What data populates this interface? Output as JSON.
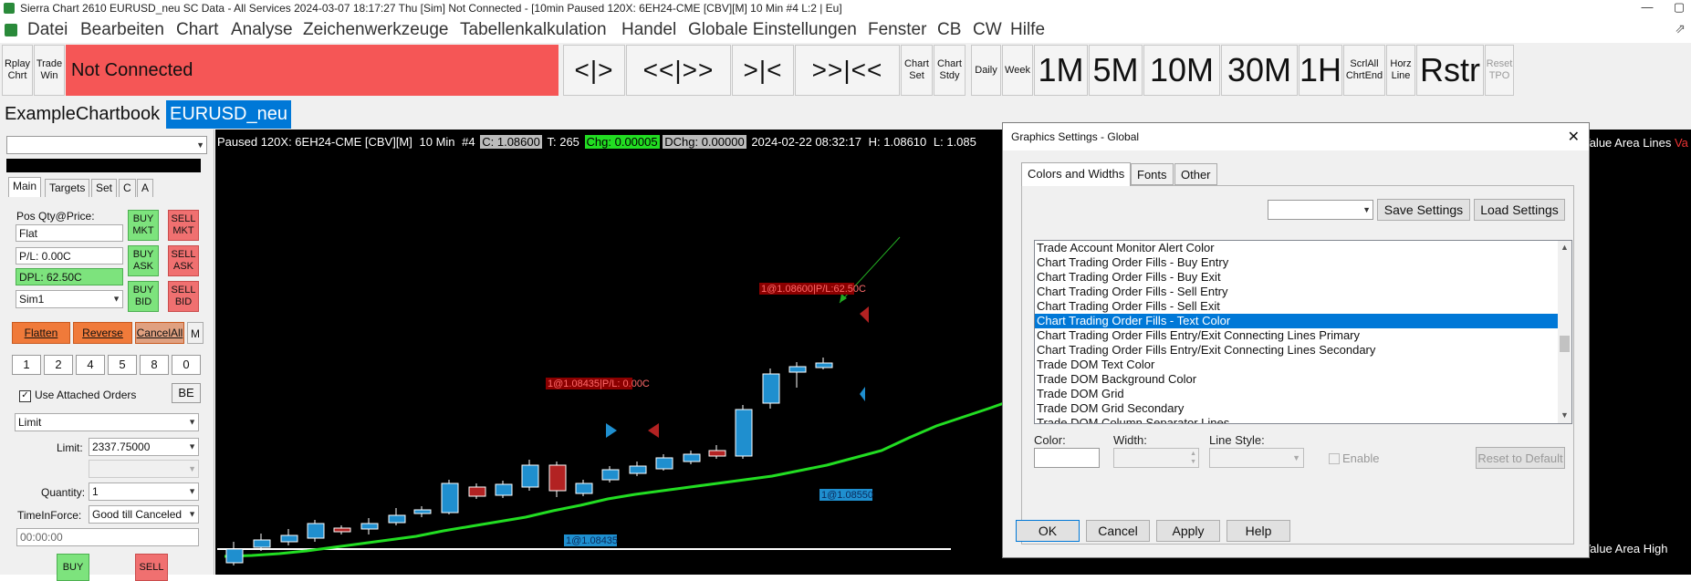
{
  "window": {
    "title": "Sierra Chart 2610 EURUSD_neu SC Data - All Services 2024-03-07  18:17:27 Thu [Sim] Not Connected - [10min Paused 120X: 6EH24-CME [CBV][M]  10 Min  #4 L:2 | Eu]",
    "minimize": "—",
    "restore": "▢",
    "menu_restore": "⇗"
  },
  "menu": [
    "Datei",
    "Bearbeiten",
    "Chart",
    "Analyse",
    "Zeichenwerkzeuge",
    "Tabellenkalkulation",
    "Handel",
    "Globale Einstellungen",
    "Fenster",
    "CB",
    "CW",
    "Hilfe"
  ],
  "toolbar": {
    "rplay": "Rplay Chrt",
    "trade_win": "Trade Win",
    "status": "Not Connected",
    "nav": [
      "<|>",
      "<<|>>",
      ">|<",
      ">>|<<"
    ],
    "chart_set": "Chart Set",
    "chart_stdy": "Chart Stdy",
    "daily": "Daily",
    "week": "Week",
    "tf": [
      "1M",
      "5M",
      "10M",
      "30M",
      "1H"
    ],
    "scrlall": "ScrlAll ChrtEnd",
    "horz": "Horz Line",
    "rstr": "Rstr",
    "reset_tpo": "Reset TPO"
  },
  "chartbook_tabs": [
    "ExampleChartbook",
    "EURUSD_neu"
  ],
  "trade_panel": {
    "tabs": [
      "Main",
      "Targets",
      "Set",
      "C",
      "A"
    ],
    "pos_label": "Pos Qty@Price:",
    "pos_value": "Flat",
    "pl_value": "P/L: 0.00C",
    "dpl_value": "DPL: 62.50C",
    "account": "Sim1",
    "buy_mkt": "BUY MKT",
    "sell_mkt": "SELL MKT",
    "buy_ask": "BUY ASK",
    "sell_ask": "SELL ASK",
    "buy_bid": "BUY BID",
    "sell_bid": "SELL BID",
    "flatten": "Flatten",
    "reverse": "Reverse",
    "cancel_all": "CancelAll",
    "m": "M",
    "qty_buttons": [
      "1",
      "2",
      "4",
      "5",
      "8",
      "0"
    ],
    "use_attached": "Use Attached Orders",
    "be": "BE",
    "order_type": "Limit",
    "limit_label": "Limit:",
    "limit_value": "2337.75000",
    "quantity_label": "Quantity:",
    "quantity_value": "1",
    "tif_label": "TimeInForce:",
    "tif_value": "Good till Canceled",
    "time_value": "00:00:00",
    "buy": "BUY",
    "sell": "SELL"
  },
  "chart": {
    "info": [
      "Paused 120X: 6EH24-CME [CBV][M]",
      "10 Min",
      "#4",
      "C: 1.08600",
      "T: 265",
      "Chg: 0.00005",
      "DChg: 0.00000",
      "2024-02-22 08:32:17",
      "H: 1.08610",
      "L: 1.085"
    ],
    "right_label_top": "Value Area Lines",
    "right_label_top_suffix": "Va",
    "right_label_bottom": "l Value Area High",
    "labels": {
      "fill_sell_1": "1@1.08600|P/L:62.50C",
      "fill_sell_2": "1@1.08435|P/L: 0.00C",
      "fill_buy_1": "1@1.08435",
      "fill_buy_2": "1@1.08550"
    },
    "colors": {
      "up": "#1f8fcf",
      "down": "#b22222",
      "ma": "#22dd22"
    }
  },
  "dialog": {
    "title": "Graphics Settings - Global",
    "close": "✕",
    "tabs": [
      "Colors and Widths",
      "Fonts",
      "Other"
    ],
    "save": "Save Settings",
    "load": "Load Settings",
    "list": [
      "Trade Account Monitor Alert Color",
      "Chart Trading Order Fills - Buy Entry",
      "Chart Trading Order Fills - Buy Exit",
      "Chart Trading Order Fills - Sell Entry",
      "Chart Trading Order Fills - Sell Exit",
      "Chart Trading Order Fills - Text Color",
      "Chart Trading Order Fills Entry/Exit Connecting Lines Primary",
      "Chart Trading Order Fills Entry/Exit Connecting Lines Secondary",
      "Trade DOM Text Color",
      "Trade DOM Background Color",
      "Trade DOM Grid",
      "Trade DOM Grid Secondary",
      "Trade DOM Column Separator Lines"
    ],
    "selected_index": 5,
    "color_label": "Color:",
    "width_label": "Width:",
    "line_style_label": "Line Style:",
    "enable_label": "Enable",
    "reset_default": "Reset to Default",
    "ok": "OK",
    "cancel": "Cancel",
    "apply": "Apply",
    "help": "Help"
  }
}
